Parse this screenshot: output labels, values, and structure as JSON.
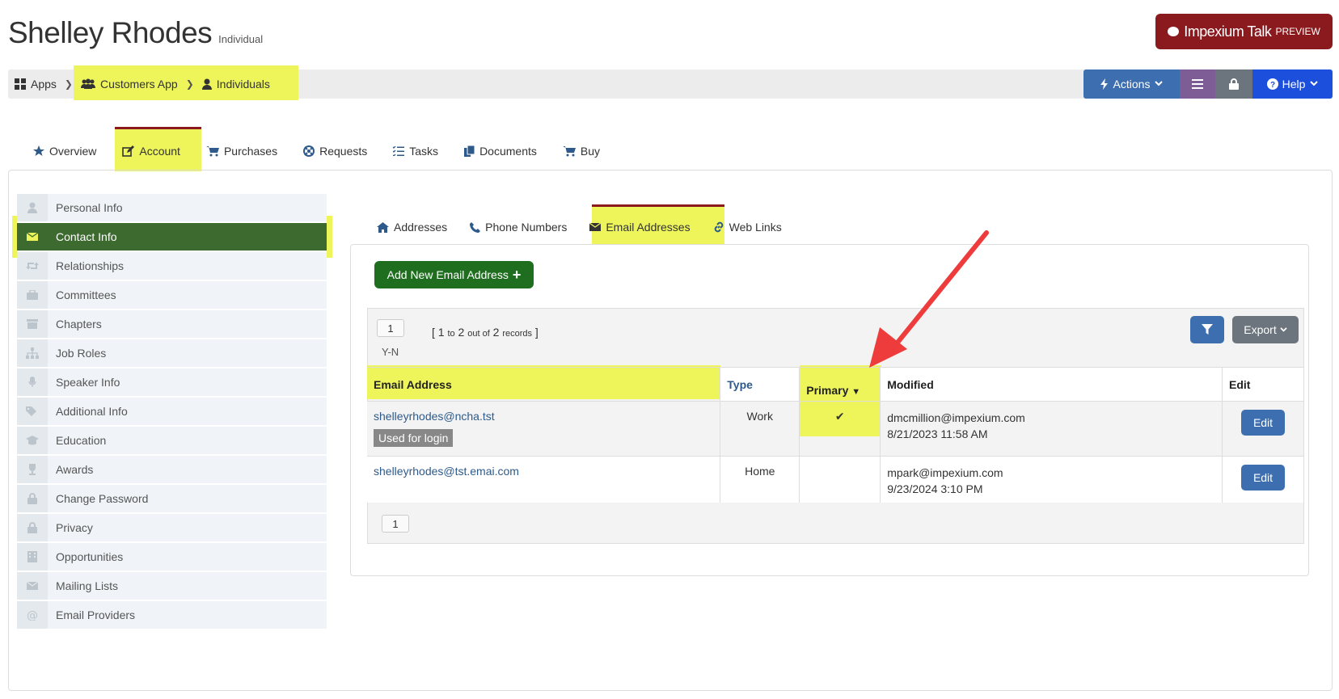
{
  "header": {
    "name": "Shelley Rhodes",
    "type_label": "Individual",
    "talk_button": {
      "label": "Impexium Talk",
      "badge": "PREVIEW"
    }
  },
  "breadcrumb": {
    "items": [
      {
        "label": "Apps",
        "icon": "grid-icon"
      },
      {
        "label": "Customers App",
        "icon": "users-icon"
      },
      {
        "label": "Individuals",
        "icon": "user-icon"
      }
    ]
  },
  "toolbar": {
    "actions_label": "Actions",
    "help_label": "Help"
  },
  "main_tabs": [
    {
      "label": "Overview",
      "icon": "star-icon"
    },
    {
      "label": "Account",
      "icon": "edit-icon"
    },
    {
      "label": "Purchases",
      "icon": "cart-icon"
    },
    {
      "label": "Requests",
      "icon": "lifebuoy-icon"
    },
    {
      "label": "Tasks",
      "icon": "tasks-icon"
    },
    {
      "label": "Documents",
      "icon": "documents-icon"
    },
    {
      "label": "Buy",
      "icon": "cart-icon"
    }
  ],
  "sidebar": {
    "items": [
      {
        "label": "Personal Info"
      },
      {
        "label": "Contact Info"
      },
      {
        "label": "Relationships"
      },
      {
        "label": "Committees"
      },
      {
        "label": "Chapters"
      },
      {
        "label": "Job Roles"
      },
      {
        "label": "Speaker Info"
      },
      {
        "label": "Additional Info"
      },
      {
        "label": "Education"
      },
      {
        "label": "Awards"
      },
      {
        "label": "Change Password"
      },
      {
        "label": "Privacy"
      },
      {
        "label": "Opportunities"
      },
      {
        "label": "Mailing Lists"
      },
      {
        "label": "Email Providers"
      }
    ]
  },
  "sub_tabs": [
    {
      "label": "Addresses",
      "icon": "home-icon"
    },
    {
      "label": "Phone Numbers",
      "icon": "phone-icon"
    },
    {
      "label": "Email Addresses",
      "icon": "envelope-icon"
    },
    {
      "label": "Web Links",
      "icon": "link-icon"
    }
  ],
  "email_panel": {
    "add_button": "Add New Email Address",
    "page_top": "1",
    "records_range": "1",
    "records_to": "to",
    "records_end": "2",
    "records_out_of": "out of",
    "records_total": "2",
    "records_word": "records",
    "sort_hint": "Y-N",
    "export_label": "Export",
    "page_bottom": "1",
    "columns": {
      "email": "Email Address",
      "type": "Type",
      "primary": "Primary",
      "modified": "Modified",
      "edit": "Edit"
    },
    "rows": [
      {
        "email": "shelleyrhodes@ncha.tst",
        "badge": "Used for login",
        "type": "Work",
        "primary": "✔",
        "modified_by": "dmcmillion@impexium.com",
        "modified_at": "8/21/2023 11:58 AM",
        "edit": "Edit"
      },
      {
        "email": "shelleyrhodes@tst.emai.com",
        "badge": "",
        "type": "Home",
        "primary": "",
        "modified_by": "mpark@impexium.com",
        "modified_at": "9/23/2024 3:10 PM",
        "edit": "Edit"
      }
    ]
  },
  "colors": {
    "highlight": "#eef55a",
    "brand_red": "#8b1a1e",
    "active_green": "#3d6b2f",
    "primary_blue": "#3d6fb0",
    "arrow": "#ee3b3b"
  }
}
